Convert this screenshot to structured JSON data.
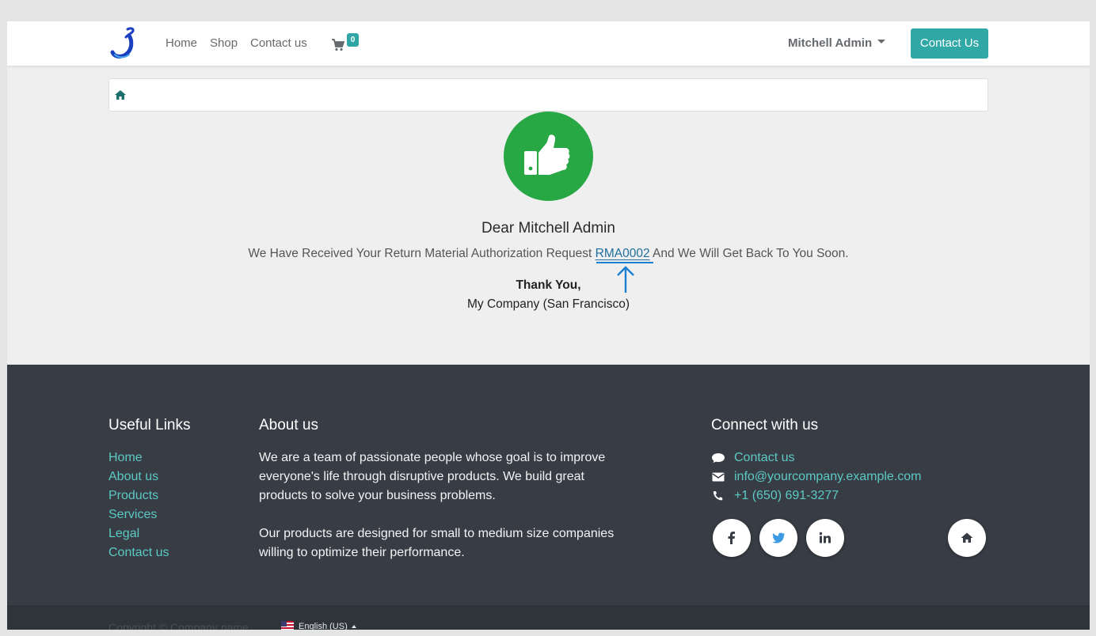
{
  "header": {
    "nav": [
      "Home",
      "Shop",
      "Contact us"
    ],
    "cart_count": "0",
    "user_name": "Mitchell Admin",
    "cta_label": "Contact Us"
  },
  "main": {
    "greeting": "Dear Mitchell Admin",
    "message_before": "We Have Received Your Return Material Authorization Request ",
    "rma_code": "RMA0002",
    "message_after": " And We Will Get Back To You Soon.",
    "thanks": "Thank You,",
    "company": "My Company (San Francisco)"
  },
  "footer": {
    "useful_links_title": "Useful Links",
    "useful_links": [
      "Home",
      "About us",
      "Products",
      "Services",
      "Legal",
      "Contact us"
    ],
    "about_title": "About us",
    "about_p1": "We are a team of passionate people whose goal is to improve everyone's life through disruptive products. We build great products to solve your business problems.",
    "about_p2": "Our products are designed for small to medium size companies willing to optimize their performance.",
    "connect_title": "Connect with us",
    "connect_items": [
      {
        "icon": "comment-icon",
        "label": "Contact us"
      },
      {
        "icon": "envelope-icon",
        "label": "info@yourcompany.example.com"
      },
      {
        "icon": "phone-icon",
        "label": "+1 (650) 691-3277"
      }
    ],
    "social": [
      "facebook-icon",
      "twitter-icon",
      "linkedin-icon",
      "home-icon"
    ]
  },
  "bottom": {
    "copyright": "Copyright © Company name",
    "language": "English (US)"
  },
  "colors": {
    "accent": "#30a8a6",
    "link": "#5bc9c4",
    "success": "#28a745",
    "footer_bg": "#383d45",
    "annotation": "#1a7fd0"
  }
}
